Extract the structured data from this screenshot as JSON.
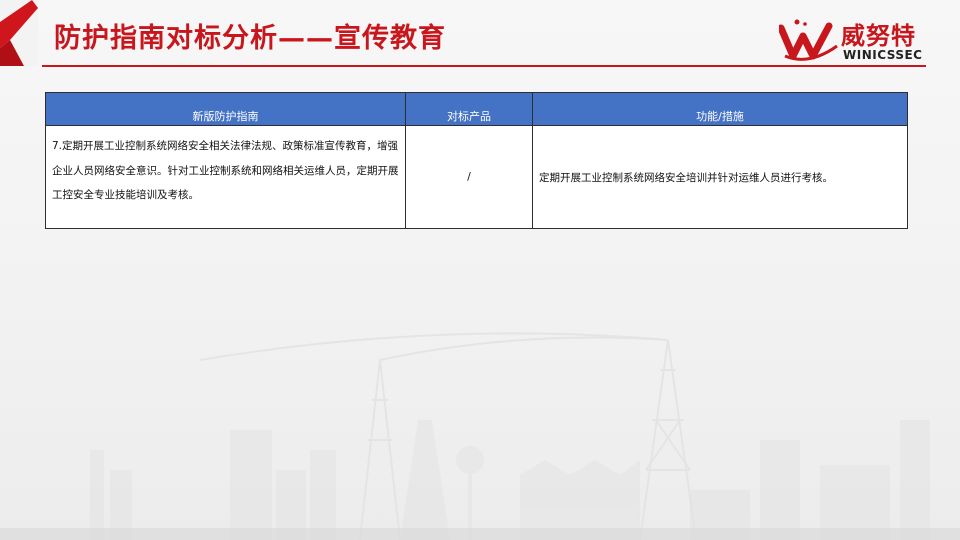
{
  "header": {
    "title": "防护指南对标分析——宣传教育"
  },
  "logo": {
    "name_cn": "威努特",
    "name_en": "WINICSSEC"
  },
  "table": {
    "columns": [
      "新版防护指南",
      "对标产品",
      "功能/措施"
    ],
    "rows": [
      {
        "guide": "7.定期开展工业控制系统网络安全相关法律法规、政策标准宣传教育，增强企业人员网络安全意识。针对工业控制系统和网络相关运维人员，定期开展工控安全专业技能培训及考核。",
        "product": "/",
        "measure": "定期开展工业控制系统网络安全培训并针对运维人员进行考核。"
      }
    ]
  },
  "colors": {
    "brand_red": "#c8161d",
    "header_blue": "#4472c4"
  }
}
